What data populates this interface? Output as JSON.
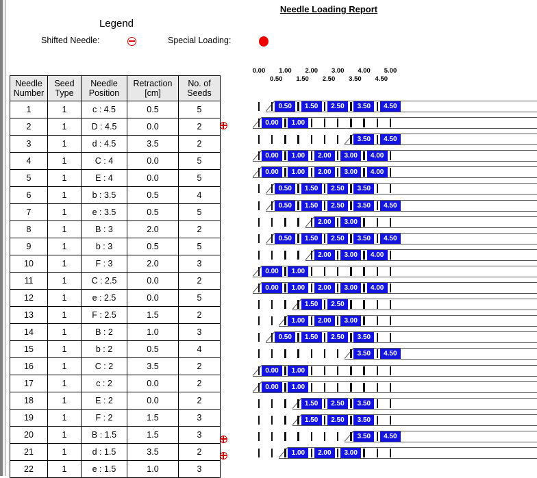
{
  "header": {
    "report_title": "Needle Loading Report",
    "legend_title": "Legend",
    "legend_shifted_label": "Shifted Needle:",
    "legend_special_label": "Special Loading:",
    "legend_shifted_icon": "circle-minus-icon",
    "legend_special_icon": "filled-circle-icon",
    "accent_blue": "#1414e0",
    "accent_red": "#ee0000"
  },
  "table": {
    "columns": [
      {
        "line1": "Needle",
        "line2": "Number"
      },
      {
        "line1": "Seed",
        "line2": "Type"
      },
      {
        "line1": "Needle",
        "line2": "Position"
      },
      {
        "line1": "Retraction",
        "line2": "[cm]"
      },
      {
        "line1": "No. of",
        "line2": "Seeds"
      }
    ],
    "rows": [
      {
        "number": "1",
        "seed_type": "1",
        "position": "c : 4.5",
        "retraction": "0.5",
        "seeds": "5"
      },
      {
        "number": "2",
        "seed_type": "1",
        "position": "D : 4.5",
        "retraction": "0.0",
        "seeds": "2"
      },
      {
        "number": "3",
        "seed_type": "1",
        "position": "d : 4.5",
        "retraction": "3.5",
        "seeds": "2"
      },
      {
        "number": "4",
        "seed_type": "1",
        "position": "C : 4",
        "retraction": "0.0",
        "seeds": "5"
      },
      {
        "number": "5",
        "seed_type": "1",
        "position": "E : 4",
        "retraction": "0.0",
        "seeds": "5"
      },
      {
        "number": "6",
        "seed_type": "1",
        "position": "b : 3.5",
        "retraction": "0.5",
        "seeds": "4"
      },
      {
        "number": "7",
        "seed_type": "1",
        "position": "e : 3.5",
        "retraction": "0.5",
        "seeds": "5"
      },
      {
        "number": "8",
        "seed_type": "1",
        "position": "B : 3",
        "retraction": "2.0",
        "seeds": "2"
      },
      {
        "number": "9",
        "seed_type": "1",
        "position": "b : 3",
        "retraction": "0.5",
        "seeds": "5"
      },
      {
        "number": "10",
        "seed_type": "1",
        "position": "F : 3",
        "retraction": "2.0",
        "seeds": "3"
      },
      {
        "number": "11",
        "seed_type": "1",
        "position": "C : 2.5",
        "retraction": "0.0",
        "seeds": "2"
      },
      {
        "number": "12",
        "seed_type": "1",
        "position": "e : 2.5",
        "retraction": "0.0",
        "seeds": "5"
      },
      {
        "number": "13",
        "seed_type": "1",
        "position": "F : 2.5",
        "retraction": "1.5",
        "seeds": "2"
      },
      {
        "number": "14",
        "seed_type": "1",
        "position": "B : 2",
        "retraction": "1.0",
        "seeds": "3"
      },
      {
        "number": "15",
        "seed_type": "1",
        "position": "b : 2",
        "retraction": "0.5",
        "seeds": "4"
      },
      {
        "number": "16",
        "seed_type": "1",
        "position": "C : 2",
        "retraction": "3.5",
        "seeds": "2"
      },
      {
        "number": "17",
        "seed_type": "1",
        "position": "c : 2",
        "retraction": "0.0",
        "seeds": "2"
      },
      {
        "number": "18",
        "seed_type": "1",
        "position": "E : 2",
        "retraction": "0.0",
        "seeds": "2"
      },
      {
        "number": "19",
        "seed_type": "1",
        "position": "F : 2",
        "retraction": "1.5",
        "seeds": "3"
      },
      {
        "number": "20",
        "seed_type": "1",
        "position": "B : 1.5",
        "retraction": "1.5",
        "seeds": "3"
      },
      {
        "number": "21",
        "seed_type": "1",
        "position": "d : 1.5",
        "retraction": "3.5",
        "seeds": "2"
      },
      {
        "number": "22",
        "seed_type": "1",
        "position": "e : 1.5",
        "retraction": "1.0",
        "seeds": "3"
      }
    ]
  },
  "chart_data": {
    "type": "table",
    "title": "Needle Loading Report",
    "xlabel": "",
    "ylabel": "",
    "xlim": [
      0.0,
      5.0
    ],
    "x_tick_step": 0.5,
    "grid": false,
    "axis_tick_labels": [
      "0.00",
      "0.50",
      "1.00",
      "1.50",
      "2.00",
      "2.50",
      "3.00",
      "3.50",
      "4.00",
      "4.50",
      "5.00"
    ],
    "axis_tick_values": [
      0.0,
      0.5,
      1.0,
      1.5,
      2.0,
      2.5,
      3.0,
      3.5,
      4.0,
      4.5,
      5.0
    ],
    "legend": [
      "Shifted Needle",
      "Special Loading"
    ],
    "shifted_needles": [
      2,
      21,
      22
    ],
    "special_loading": [],
    "rows": [
      {
        "needle": 1,
        "retraction": 0.5,
        "loaded": [
          0.5,
          1.5,
          2.5,
          3.5,
          4.5
        ]
      },
      {
        "needle": 2,
        "retraction": 0.0,
        "loaded": [
          0.0,
          1.0
        ],
        "shifted": true
      },
      {
        "needle": 3,
        "retraction": 3.5,
        "loaded": [
          3.5,
          4.5
        ]
      },
      {
        "needle": 4,
        "retraction": 0.0,
        "loaded": [
          0.0,
          1.0,
          2.0,
          3.0,
          4.0
        ]
      },
      {
        "needle": 5,
        "retraction": 0.0,
        "loaded": [
          0.0,
          1.0,
          2.0,
          3.0,
          4.0
        ]
      },
      {
        "needle": 6,
        "retraction": 0.5,
        "loaded": [
          0.5,
          1.5,
          2.5,
          3.5
        ]
      },
      {
        "needle": 7,
        "retraction": 0.5,
        "loaded": [
          0.5,
          1.5,
          2.5,
          3.5,
          4.5
        ]
      },
      {
        "needle": 8,
        "retraction": 2.0,
        "loaded": [
          2.0,
          3.0
        ]
      },
      {
        "needle": 9,
        "retraction": 0.5,
        "loaded": [
          0.5,
          1.5,
          2.5,
          3.5,
          4.5
        ]
      },
      {
        "needle": 10,
        "retraction": 2.0,
        "loaded": [
          2.0,
          3.0,
          4.0
        ]
      },
      {
        "needle": 11,
        "retraction": 0.0,
        "loaded": [
          0.0,
          1.0
        ]
      },
      {
        "needle": 12,
        "retraction": 0.0,
        "loaded": [
          0.0,
          1.0,
          2.0,
          3.0,
          4.0
        ]
      },
      {
        "needle": 13,
        "retraction": 1.5,
        "loaded": [
          1.5,
          2.5
        ]
      },
      {
        "needle": 14,
        "retraction": 1.0,
        "loaded": [
          1.0,
          2.0,
          3.0
        ]
      },
      {
        "needle": 15,
        "retraction": 0.5,
        "loaded": [
          0.5,
          1.5,
          2.5,
          3.5
        ]
      },
      {
        "needle": 16,
        "retraction": 3.5,
        "loaded": [
          3.5,
          4.5
        ]
      },
      {
        "needle": 17,
        "retraction": 0.0,
        "loaded": [
          0.0,
          1.0
        ]
      },
      {
        "needle": 18,
        "retraction": 0.0,
        "loaded": [
          0.0,
          1.0
        ]
      },
      {
        "needle": 19,
        "retraction": 1.5,
        "loaded": [
          1.5,
          2.5,
          3.5
        ]
      },
      {
        "needle": 20,
        "retraction": 1.5,
        "loaded": [
          1.5,
          2.5,
          3.5
        ]
      },
      {
        "needle": 21,
        "retraction": 3.5,
        "loaded": [
          3.5,
          4.5
        ],
        "shifted": true
      },
      {
        "needle": 22,
        "retraction": 1.0,
        "loaded": [
          1.0,
          2.0,
          3.0
        ],
        "shifted": true
      }
    ]
  }
}
